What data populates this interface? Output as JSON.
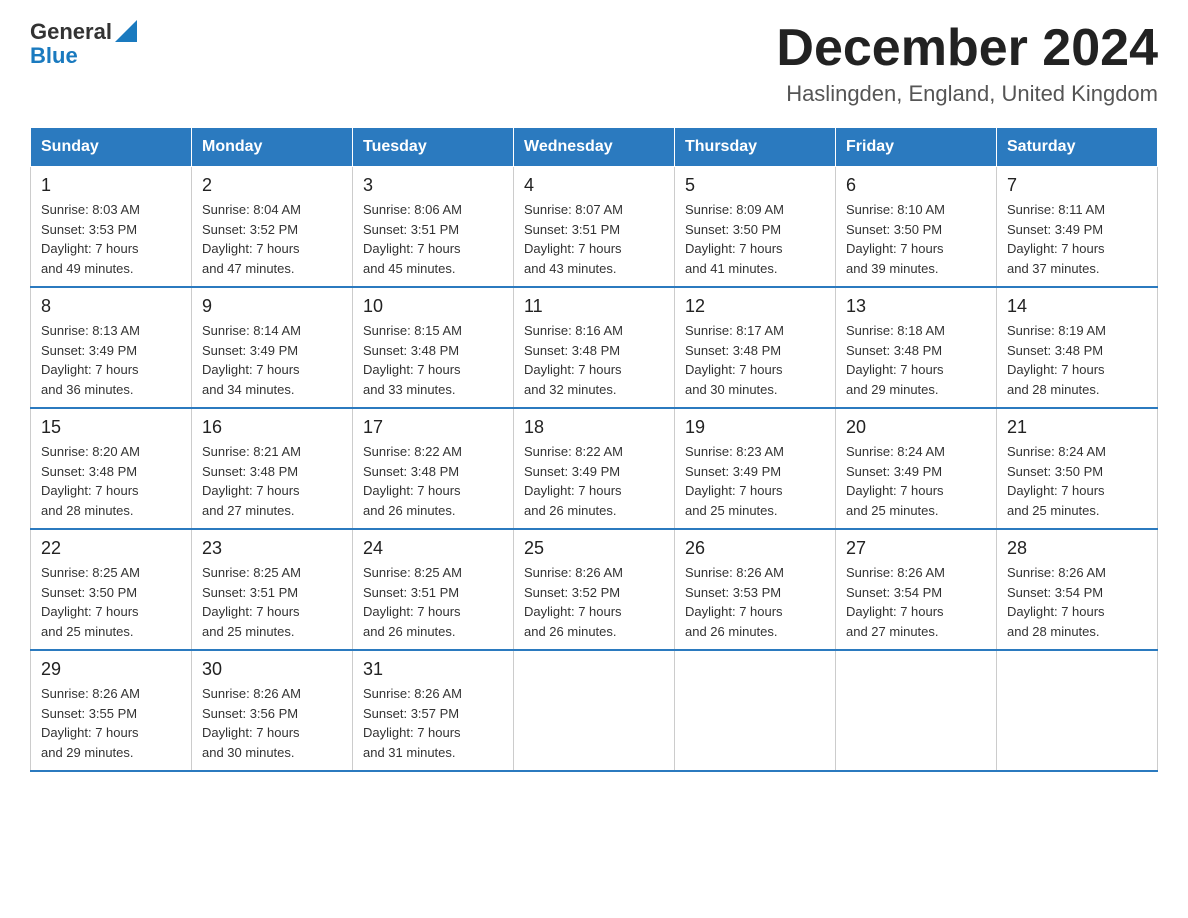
{
  "header": {
    "logo": {
      "general": "General",
      "blue": "Blue"
    },
    "title": "December 2024",
    "location": "Haslingden, England, United Kingdom"
  },
  "calendar": {
    "days_of_week": [
      "Sunday",
      "Monday",
      "Tuesday",
      "Wednesday",
      "Thursday",
      "Friday",
      "Saturday"
    ],
    "weeks": [
      [
        {
          "day": "1",
          "info": "Sunrise: 8:03 AM\nSunset: 3:53 PM\nDaylight: 7 hours\nand 49 minutes."
        },
        {
          "day": "2",
          "info": "Sunrise: 8:04 AM\nSunset: 3:52 PM\nDaylight: 7 hours\nand 47 minutes."
        },
        {
          "day": "3",
          "info": "Sunrise: 8:06 AM\nSunset: 3:51 PM\nDaylight: 7 hours\nand 45 minutes."
        },
        {
          "day": "4",
          "info": "Sunrise: 8:07 AM\nSunset: 3:51 PM\nDaylight: 7 hours\nand 43 minutes."
        },
        {
          "day": "5",
          "info": "Sunrise: 8:09 AM\nSunset: 3:50 PM\nDaylight: 7 hours\nand 41 minutes."
        },
        {
          "day": "6",
          "info": "Sunrise: 8:10 AM\nSunset: 3:50 PM\nDaylight: 7 hours\nand 39 minutes."
        },
        {
          "day": "7",
          "info": "Sunrise: 8:11 AM\nSunset: 3:49 PM\nDaylight: 7 hours\nand 37 minutes."
        }
      ],
      [
        {
          "day": "8",
          "info": "Sunrise: 8:13 AM\nSunset: 3:49 PM\nDaylight: 7 hours\nand 36 minutes."
        },
        {
          "day": "9",
          "info": "Sunrise: 8:14 AM\nSunset: 3:49 PM\nDaylight: 7 hours\nand 34 minutes."
        },
        {
          "day": "10",
          "info": "Sunrise: 8:15 AM\nSunset: 3:48 PM\nDaylight: 7 hours\nand 33 minutes."
        },
        {
          "day": "11",
          "info": "Sunrise: 8:16 AM\nSunset: 3:48 PM\nDaylight: 7 hours\nand 32 minutes."
        },
        {
          "day": "12",
          "info": "Sunrise: 8:17 AM\nSunset: 3:48 PM\nDaylight: 7 hours\nand 30 minutes."
        },
        {
          "day": "13",
          "info": "Sunrise: 8:18 AM\nSunset: 3:48 PM\nDaylight: 7 hours\nand 29 minutes."
        },
        {
          "day": "14",
          "info": "Sunrise: 8:19 AM\nSunset: 3:48 PM\nDaylight: 7 hours\nand 28 minutes."
        }
      ],
      [
        {
          "day": "15",
          "info": "Sunrise: 8:20 AM\nSunset: 3:48 PM\nDaylight: 7 hours\nand 28 minutes."
        },
        {
          "day": "16",
          "info": "Sunrise: 8:21 AM\nSunset: 3:48 PM\nDaylight: 7 hours\nand 27 minutes."
        },
        {
          "day": "17",
          "info": "Sunrise: 8:22 AM\nSunset: 3:48 PM\nDaylight: 7 hours\nand 26 minutes."
        },
        {
          "day": "18",
          "info": "Sunrise: 8:22 AM\nSunset: 3:49 PM\nDaylight: 7 hours\nand 26 minutes."
        },
        {
          "day": "19",
          "info": "Sunrise: 8:23 AM\nSunset: 3:49 PM\nDaylight: 7 hours\nand 25 minutes."
        },
        {
          "day": "20",
          "info": "Sunrise: 8:24 AM\nSunset: 3:49 PM\nDaylight: 7 hours\nand 25 minutes."
        },
        {
          "day": "21",
          "info": "Sunrise: 8:24 AM\nSunset: 3:50 PM\nDaylight: 7 hours\nand 25 minutes."
        }
      ],
      [
        {
          "day": "22",
          "info": "Sunrise: 8:25 AM\nSunset: 3:50 PM\nDaylight: 7 hours\nand 25 minutes."
        },
        {
          "day": "23",
          "info": "Sunrise: 8:25 AM\nSunset: 3:51 PM\nDaylight: 7 hours\nand 25 minutes."
        },
        {
          "day": "24",
          "info": "Sunrise: 8:25 AM\nSunset: 3:51 PM\nDaylight: 7 hours\nand 26 minutes."
        },
        {
          "day": "25",
          "info": "Sunrise: 8:26 AM\nSunset: 3:52 PM\nDaylight: 7 hours\nand 26 minutes."
        },
        {
          "day": "26",
          "info": "Sunrise: 8:26 AM\nSunset: 3:53 PM\nDaylight: 7 hours\nand 26 minutes."
        },
        {
          "day": "27",
          "info": "Sunrise: 8:26 AM\nSunset: 3:54 PM\nDaylight: 7 hours\nand 27 minutes."
        },
        {
          "day": "28",
          "info": "Sunrise: 8:26 AM\nSunset: 3:54 PM\nDaylight: 7 hours\nand 28 minutes."
        }
      ],
      [
        {
          "day": "29",
          "info": "Sunrise: 8:26 AM\nSunset: 3:55 PM\nDaylight: 7 hours\nand 29 minutes."
        },
        {
          "day": "30",
          "info": "Sunrise: 8:26 AM\nSunset: 3:56 PM\nDaylight: 7 hours\nand 30 minutes."
        },
        {
          "day": "31",
          "info": "Sunrise: 8:26 AM\nSunset: 3:57 PM\nDaylight: 7 hours\nand 31 minutes."
        },
        {
          "day": "",
          "info": ""
        },
        {
          "day": "",
          "info": ""
        },
        {
          "day": "",
          "info": ""
        },
        {
          "day": "",
          "info": ""
        }
      ]
    ]
  }
}
